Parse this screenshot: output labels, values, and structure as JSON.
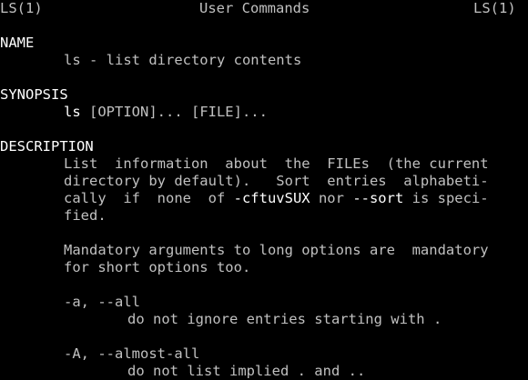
{
  "header": {
    "left": "LS(1)",
    "center": "User Commands",
    "right": "LS(1)"
  },
  "sections": {
    "name": {
      "heading": "NAME",
      "text": "ls - list directory contents"
    },
    "synopsis": {
      "heading": "SYNOPSIS",
      "command": "ls",
      "args": " [OPTION]... [FILE]..."
    },
    "description": {
      "heading": "DESCRIPTION",
      "para1": {
        "line1": "List  information  about  the  FILEs  (the current",
        "line2": "directory by default).   Sort  entries  alphabeti-",
        "line3_pre": "cally  if  none  of ",
        "line3_opt1": "-cftuvSUX",
        "line3_mid": " nor ",
        "line3_opt2": "--sort",
        "line3_post": " is speci-",
        "line4": "fied."
      },
      "para2": {
        "line1": "Mandatory arguments to long options are  mandatory",
        "line2": "for short options too."
      },
      "options": [
        {
          "flag": "-a, --all",
          "desc": "do not ignore entries starting with ."
        },
        {
          "flag": "-A, --almost-all",
          "desc": "do not list implied . and .."
        }
      ]
    }
  }
}
